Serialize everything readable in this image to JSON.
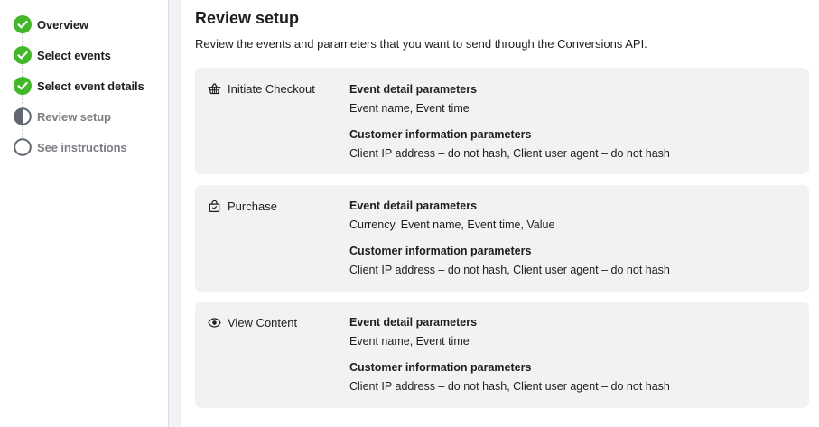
{
  "steps": [
    {
      "label": "Overview",
      "status": "done"
    },
    {
      "label": "Select events",
      "status": "done"
    },
    {
      "label": "Select event details",
      "status": "done"
    },
    {
      "label": "Review setup",
      "status": "current"
    },
    {
      "label": "See instructions",
      "status": "pending"
    }
  ],
  "main": {
    "title": "Review setup",
    "subtitle": "Review the events and parameters that you want to send through the Conversions API."
  },
  "events": [
    {
      "name": "Initiate Checkout",
      "icon": "basket-icon",
      "event_heading": "Event detail parameters",
      "event_params": "Event name, Event time",
      "customer_heading": "Customer information parameters",
      "customer_params": "Client IP address – do not hash, Client user agent – do not hash"
    },
    {
      "name": "Purchase",
      "icon": "shopping-bag-icon",
      "event_heading": "Event detail parameters",
      "event_params": "Currency, Event name, Event time, Value",
      "customer_heading": "Customer information parameters",
      "customer_params": "Client IP address – do not hash, Client user agent – do not hash"
    },
    {
      "name": "View Content",
      "icon": "eye-icon",
      "event_heading": "Event detail parameters",
      "event_params": "Event name, Event time",
      "customer_heading": "Customer information parameters",
      "customer_params": "Client IP address – do not hash, Client user agent – do not hash"
    }
  ],
  "colors": {
    "done": "#42b72a",
    "pending": "#7a7d82",
    "card": "#f2f2f2",
    "gutter": "#f0f2f5"
  }
}
